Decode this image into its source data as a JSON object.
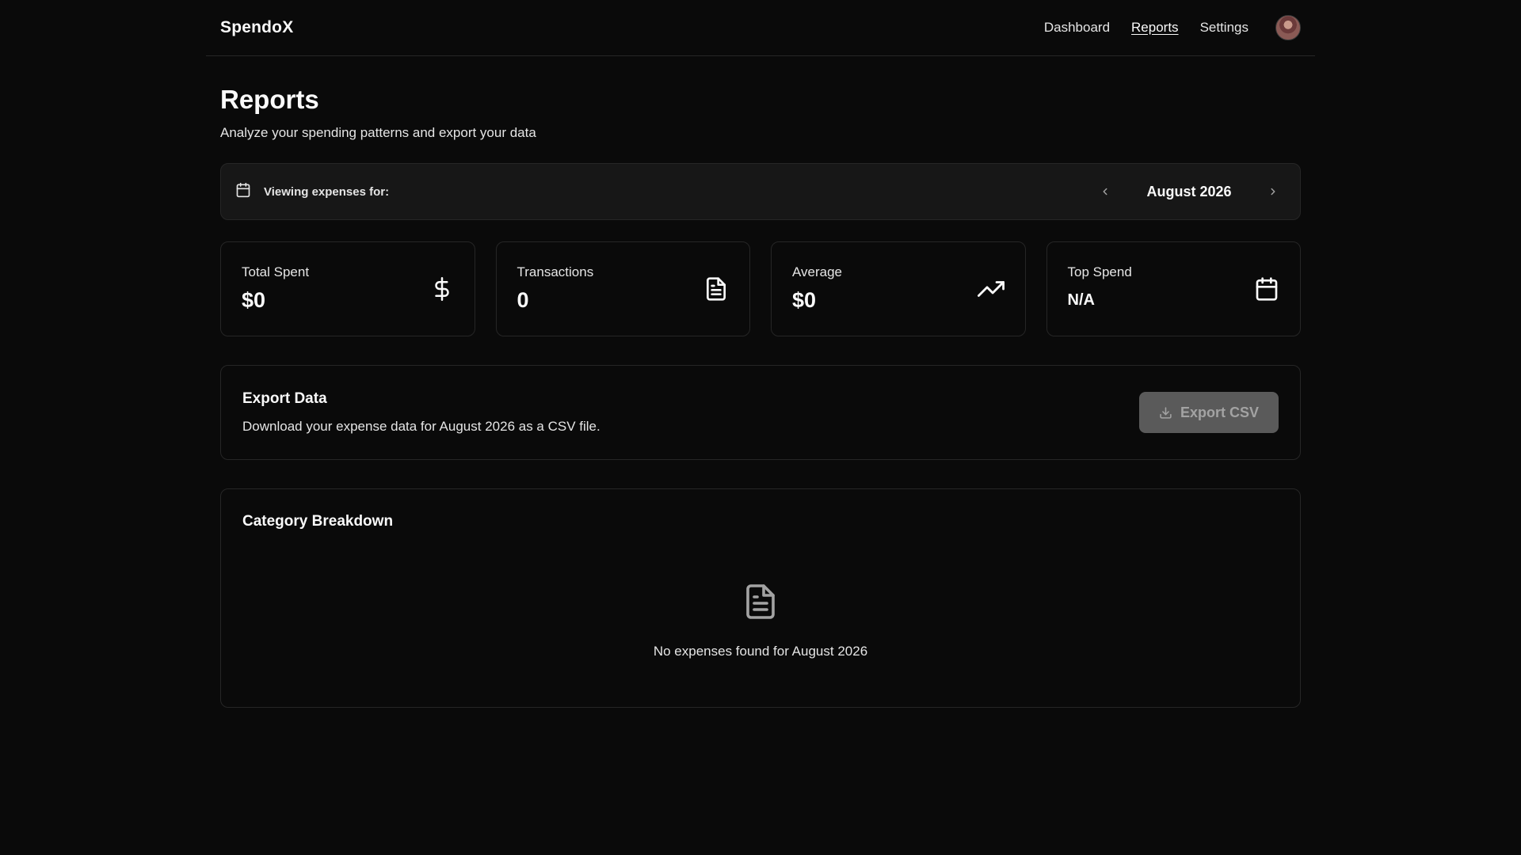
{
  "app": {
    "brand": "SpendoX"
  },
  "nav": {
    "items": [
      {
        "label": "Dashboard",
        "active": false
      },
      {
        "label": "Reports",
        "active": true
      },
      {
        "label": "Settings",
        "active": false
      }
    ]
  },
  "page": {
    "title": "Reports",
    "subtitle": "Analyze your spending patterns and export your data"
  },
  "month_selector": {
    "label": "Viewing expenses for:",
    "value": "August 2026",
    "icon": "calendar-icon"
  },
  "stats": [
    {
      "label": "Total Spent",
      "value": "$0",
      "icon": "dollar-icon"
    },
    {
      "label": "Transactions",
      "value": "0",
      "icon": "document-icon"
    },
    {
      "label": "Average",
      "value": "$0",
      "icon": "trending-up-icon"
    },
    {
      "label": "Top Spend",
      "value": "N/A",
      "icon": "calendar-icon"
    }
  ],
  "export": {
    "title": "Export Data",
    "description": "Download your expense data for August 2026 as a CSV file.",
    "button_label": "Export CSV",
    "button_icon": "download-icon",
    "button_disabled": true
  },
  "category": {
    "title": "Category Breakdown",
    "empty_icon": "document-icon",
    "empty_text": "No expenses found for August 2026"
  },
  "colors": {
    "background": "#0a0a0a",
    "card_border": "#262626",
    "month_bar_bg": "#171717",
    "text": "#fafafa",
    "muted_text": "#e5e5e5",
    "disabled_button_bg": "#5a5a5a"
  }
}
